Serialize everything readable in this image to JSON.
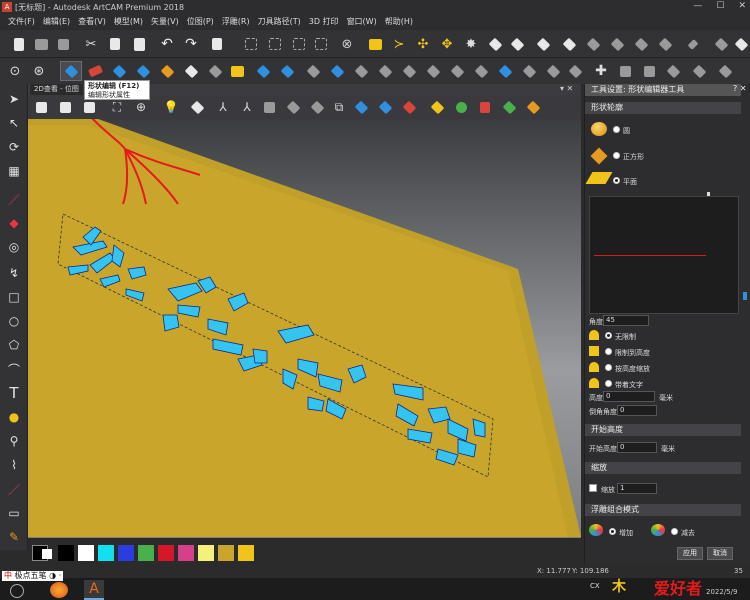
{
  "window": {
    "title": "[无标题] - Autodesk ArtCAM Premium 2018"
  },
  "menu": [
    "文件(F)",
    "编辑(E)",
    "查看(V)",
    "模型(M)",
    "矢量(V)",
    "位图(P)",
    "浮雕(R)",
    "刀具路径(T)",
    "3D 打印",
    "窗口(W)",
    "帮助(H)"
  ],
  "view_tab": "2D查看 - 位图",
  "tooltip": {
    "title": "形状编辑 (F12)",
    "body": "编辑形状属性"
  },
  "panel": {
    "title": "工具设置: 形状编辑器工具",
    "section_profile": "形状轮廓",
    "profile_options": [
      "圆",
      "正方形",
      "平面"
    ],
    "angle_label": "角度",
    "angle_value": "45",
    "limit_options": [
      "无限制",
      "限制到高度",
      "按高度缩放",
      "带着文字"
    ],
    "height_label": "高度",
    "height_value": "0",
    "height_unit": "毫米",
    "bevel_label": "倒角角度",
    "bevel_value": "0",
    "section_start": "开始高度",
    "start_label": "开始高度",
    "start_value": "0",
    "start_unit": "毫米",
    "section_scale": "缩放",
    "scale_label": "缩放",
    "scale_value": "1",
    "section_combine": "浮雕组合模式",
    "combine_add": "增加",
    "combine_subtract": "减去",
    "apply_button": "应用",
    "cancel_button": "取消"
  },
  "status": {
    "x": "X: 11.777",
    "y": "Y: 109.186",
    "extra": "35"
  },
  "taskbar": {
    "ime": "极点五笔",
    "date": "2022/5/9",
    "watermark": "爱好者"
  },
  "colors": {
    "relief_plane": "#c9a62b",
    "vector_fill": "#35c3ef",
    "accent_blue": "#2f8fe0"
  }
}
